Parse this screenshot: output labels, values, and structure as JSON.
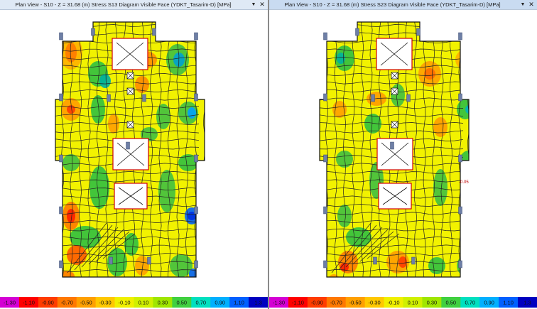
{
  "panes": [
    {
      "title": "Plan View - S10 - Z = 31.68 (m)    Stress S13 Diagram  Visible Face    (YDKT_Tasarim-D)  [MPa]",
      "pin_icon": "pin-icon",
      "close_icon": "close-icon",
      "legend_tick_labels": [
        "-1.30",
        "-1.10",
        "-0.90",
        "-0.70",
        "-0.50",
        "-0.30",
        "-0.10",
        "0.10",
        "0.30",
        "0.50",
        "0.70",
        "0.90",
        "1.10",
        "1.3"
      ]
    },
    {
      "title": "Plan View - S10 - Z = 31.68 (m)    Stress S23 Diagram  Visible Face    (YDKT_Tasarim-D)  [MPa]",
      "pin_icon": "pin-icon",
      "close_icon": "close-icon",
      "annotation": "-0.05",
      "legend_tick_labels": [
        "-1.30",
        "-1.10",
        "-0.90",
        "-0.70",
        "-0.50",
        "-0.30",
        "-0.10",
        "0.10",
        "0.30",
        "0.50",
        "0.70",
        "0.90",
        "1.10",
        "1.3"
      ]
    }
  ],
  "legend_colors": [
    "#d400d4",
    "#ff0000",
    "#ff3c00",
    "#ff7800",
    "#ffa000",
    "#ffc800",
    "#f0f000",
    "#d0f000",
    "#a0e600",
    "#40d040",
    "#00e0c0",
    "#00b0ff",
    "#0060ff",
    "#0000c0"
  ],
  "colors": {
    "stress_base": "#f2f200",
    "mesh": "#222222",
    "opening_fill": "#ffffff",
    "opening_border": "#d00000",
    "support": "#6e7fa6"
  }
}
